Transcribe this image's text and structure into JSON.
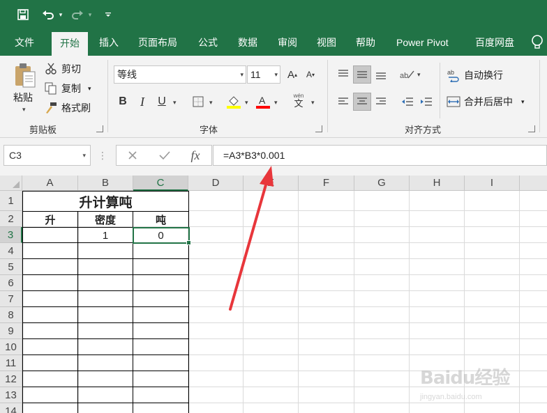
{
  "quick_access": {
    "save_icon": "save-icon",
    "undo_icon": "undo-icon",
    "redo_icon": "redo-icon",
    "customize_icon": "customize-qat-icon"
  },
  "tabs": [
    {
      "label": "文件"
    },
    {
      "label": "开始"
    },
    {
      "label": "插入"
    },
    {
      "label": "页面布局"
    },
    {
      "label": "公式"
    },
    {
      "label": "数据"
    },
    {
      "label": "审阅"
    },
    {
      "label": "视图"
    },
    {
      "label": "帮助"
    },
    {
      "label": "Power Pivot"
    },
    {
      "label": "百度网盘"
    }
  ],
  "active_tab": "开始",
  "ribbon": {
    "clipboard": {
      "paste": "粘贴",
      "cut": "剪切",
      "copy": "复制",
      "format_painter": "格式刷",
      "group_label": "剪贴板"
    },
    "font": {
      "font_name": "等线",
      "font_size": "11",
      "bold": "B",
      "italic": "I",
      "underline": "U",
      "phonetic_top": "wén",
      "phonetic_bottom": "文",
      "group_label": "字体",
      "fill_color": "#ffff00",
      "font_color": "#ff0000"
    },
    "alignment": {
      "wrap_text": "自动换行",
      "merge_center": "合并后居中",
      "group_label": "对齐方式"
    }
  },
  "formula_bar": {
    "name_box": "C3",
    "cancel_icon": "cancel-icon",
    "enter_icon": "enter-icon",
    "fx_label": "fx",
    "formula": "=A3*B3*0.001"
  },
  "sheet": {
    "columns": [
      "A",
      "B",
      "C",
      "D",
      "E",
      "F",
      "G",
      "H",
      "I"
    ],
    "rows": [
      "1",
      "2",
      "3",
      "4",
      "5",
      "6",
      "7",
      "8",
      "9",
      "10",
      "11",
      "12",
      "13",
      "14"
    ],
    "title": "升计算吨",
    "headers": [
      "升",
      "密度",
      "吨"
    ],
    "row3": {
      "a": "",
      "b": "1",
      "c": "0"
    },
    "selected_cell": "C3"
  },
  "annotation": {
    "arrow_color": "#e8363b"
  },
  "watermark": {
    "logo": "Baidu经验",
    "url": "jingyan.baidu.com"
  },
  "colors": {
    "accent": "#217346"
  }
}
